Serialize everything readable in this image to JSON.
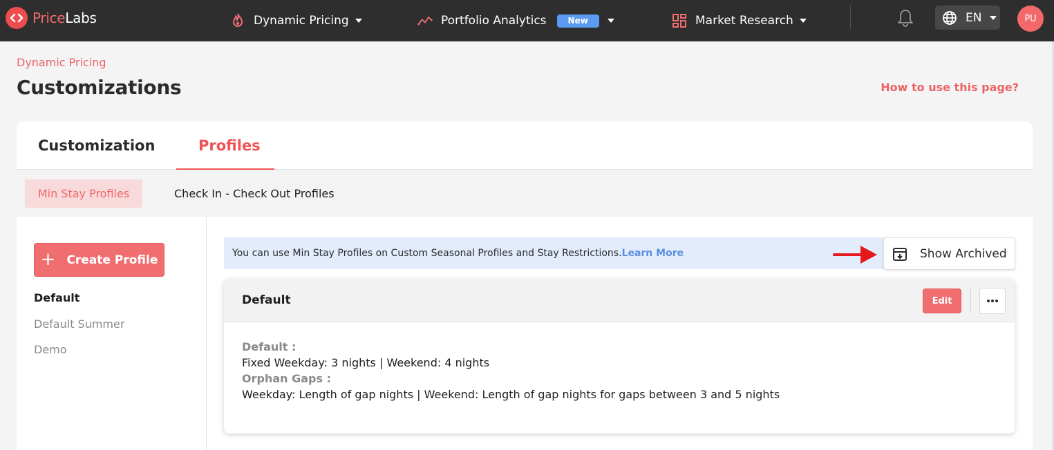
{
  "brand": {
    "name_part1": "Price",
    "name_part2": "Labs"
  },
  "nav": {
    "items": [
      {
        "label": "Dynamic Pricing",
        "icon": "flame-icon"
      },
      {
        "label": "Portfolio Analytics",
        "icon": "trend-icon",
        "badge": "New"
      },
      {
        "label": "Market Research",
        "icon": "grid-icon"
      }
    ],
    "language": "EN",
    "avatar_initials": "PU"
  },
  "page": {
    "breadcrumb": "Dynamic Pricing",
    "title": "Customizations",
    "help_link": "How to use this page?"
  },
  "tabs": [
    {
      "label": "Customization",
      "active": false
    },
    {
      "label": "Profiles",
      "active": true
    }
  ],
  "subtabs": [
    {
      "label": "Min Stay Profiles",
      "active": true
    },
    {
      "label": "Check In - Check Out Profiles",
      "active": false
    }
  ],
  "sidebar": {
    "create_label": "Create Profile",
    "profiles": [
      {
        "name": "Default",
        "active": true
      },
      {
        "name": "Default Summer",
        "active": false
      },
      {
        "name": "Demo",
        "active": false
      }
    ]
  },
  "main": {
    "info_text": "You can use Min Stay Profiles on Custom Seasonal Profiles and Stay Restrictions.",
    "learn_more": "Learn More",
    "show_archived_label": "Show Archived",
    "profile_card": {
      "title": "Default",
      "edit_label": "Edit",
      "default_label": "Default :",
      "default_value": "Fixed Weekday: 3 nights | Weekend: 4 nights",
      "orphan_label": "Orphan Gaps :",
      "orphan_value": "Weekday: Length of gap nights | Weekend: Length of gap nights for gaps between 3 and 5 nights"
    }
  },
  "colors": {
    "accent": "#ef5355",
    "topbar": "#2e2e2e",
    "badge": "#5b9cf2",
    "annotation_arrow": "#e5191e"
  }
}
